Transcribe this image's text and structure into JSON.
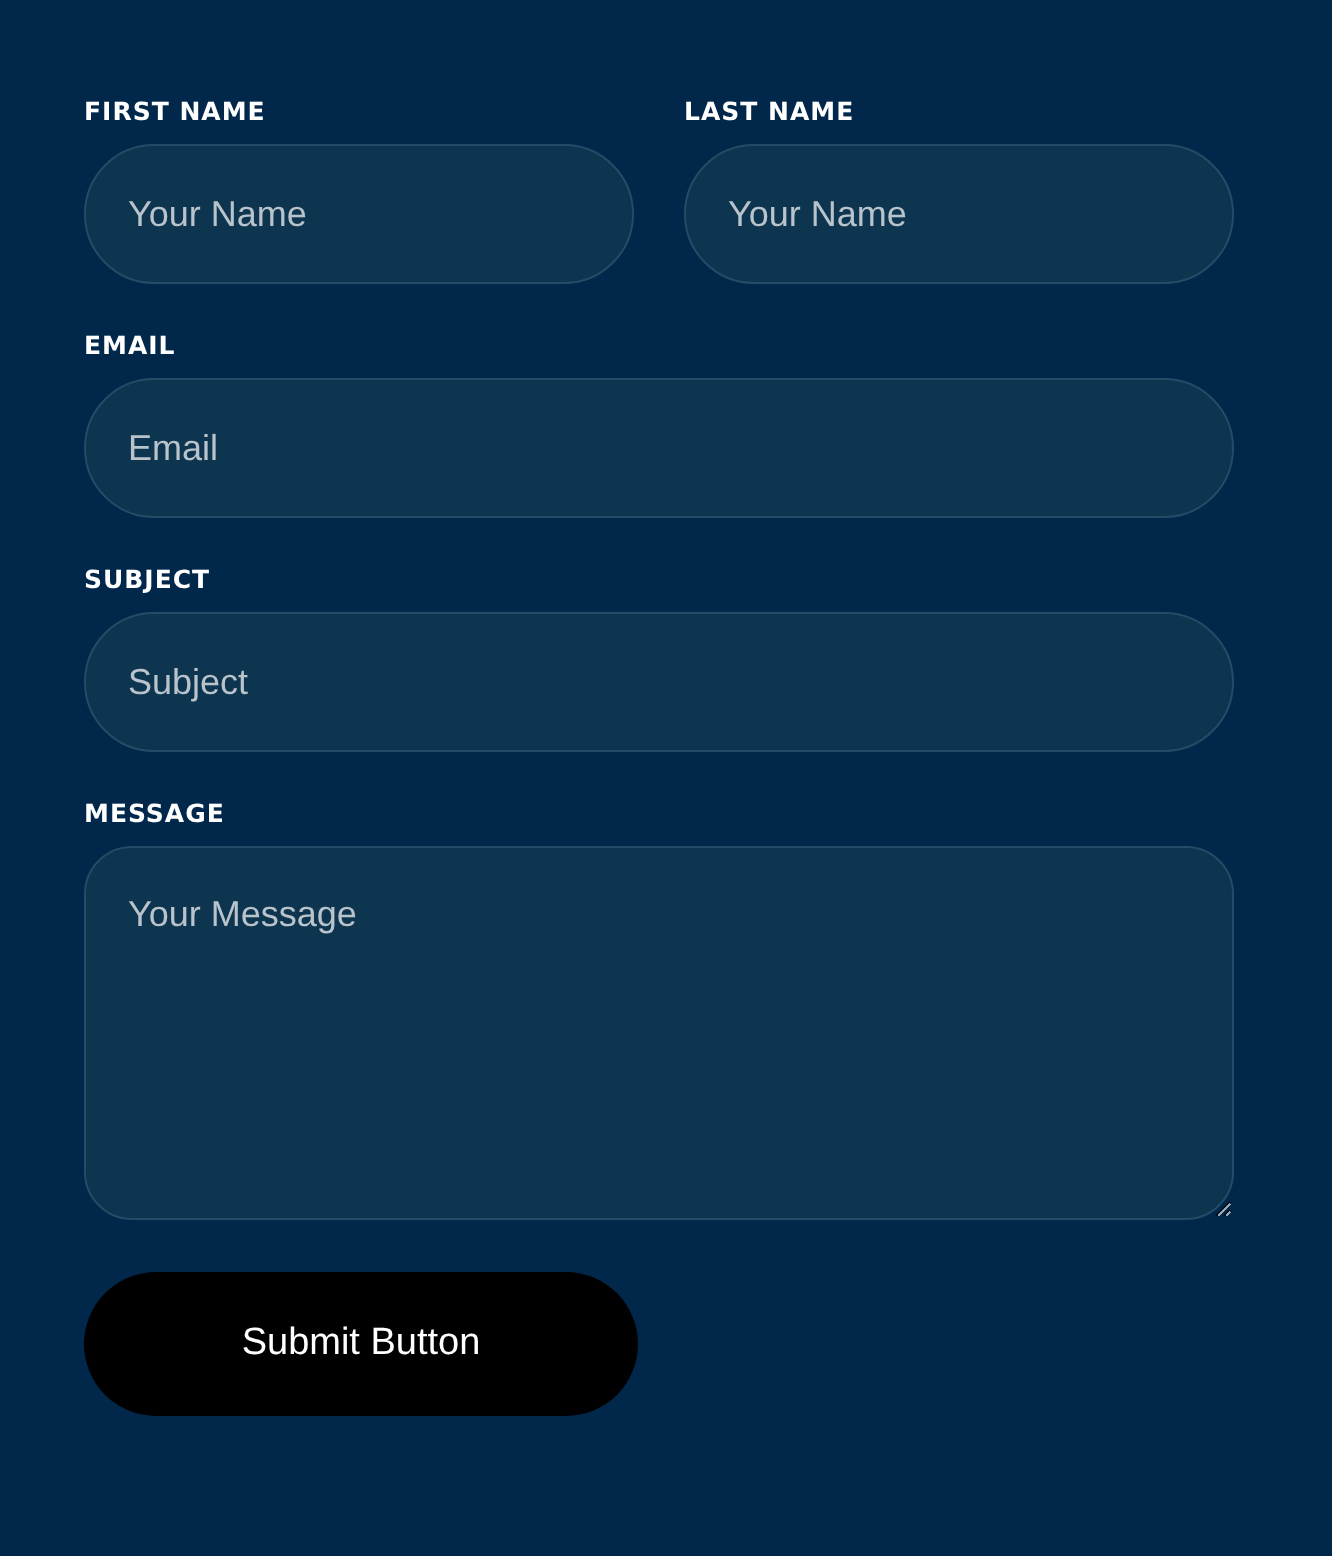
{
  "form": {
    "rows": [
      {
        "fields": [
          {
            "label": "FIRST NAME",
            "placeholder": "Your Name",
            "kind": "input"
          },
          {
            "label": "LAST NAME",
            "placeholder": "Your Name",
            "kind": "input"
          }
        ]
      },
      {
        "fields": [
          {
            "label": "EMAIL",
            "placeholder": "Email",
            "kind": "input"
          }
        ]
      },
      {
        "fields": [
          {
            "label": "SUBJECT",
            "placeholder": "Subject",
            "kind": "input"
          }
        ]
      },
      {
        "fields": [
          {
            "label": "MESSAGE",
            "placeholder": "Your Message",
            "kind": "textarea"
          }
        ]
      }
    ],
    "submit": {
      "label": "Submit Button"
    }
  }
}
